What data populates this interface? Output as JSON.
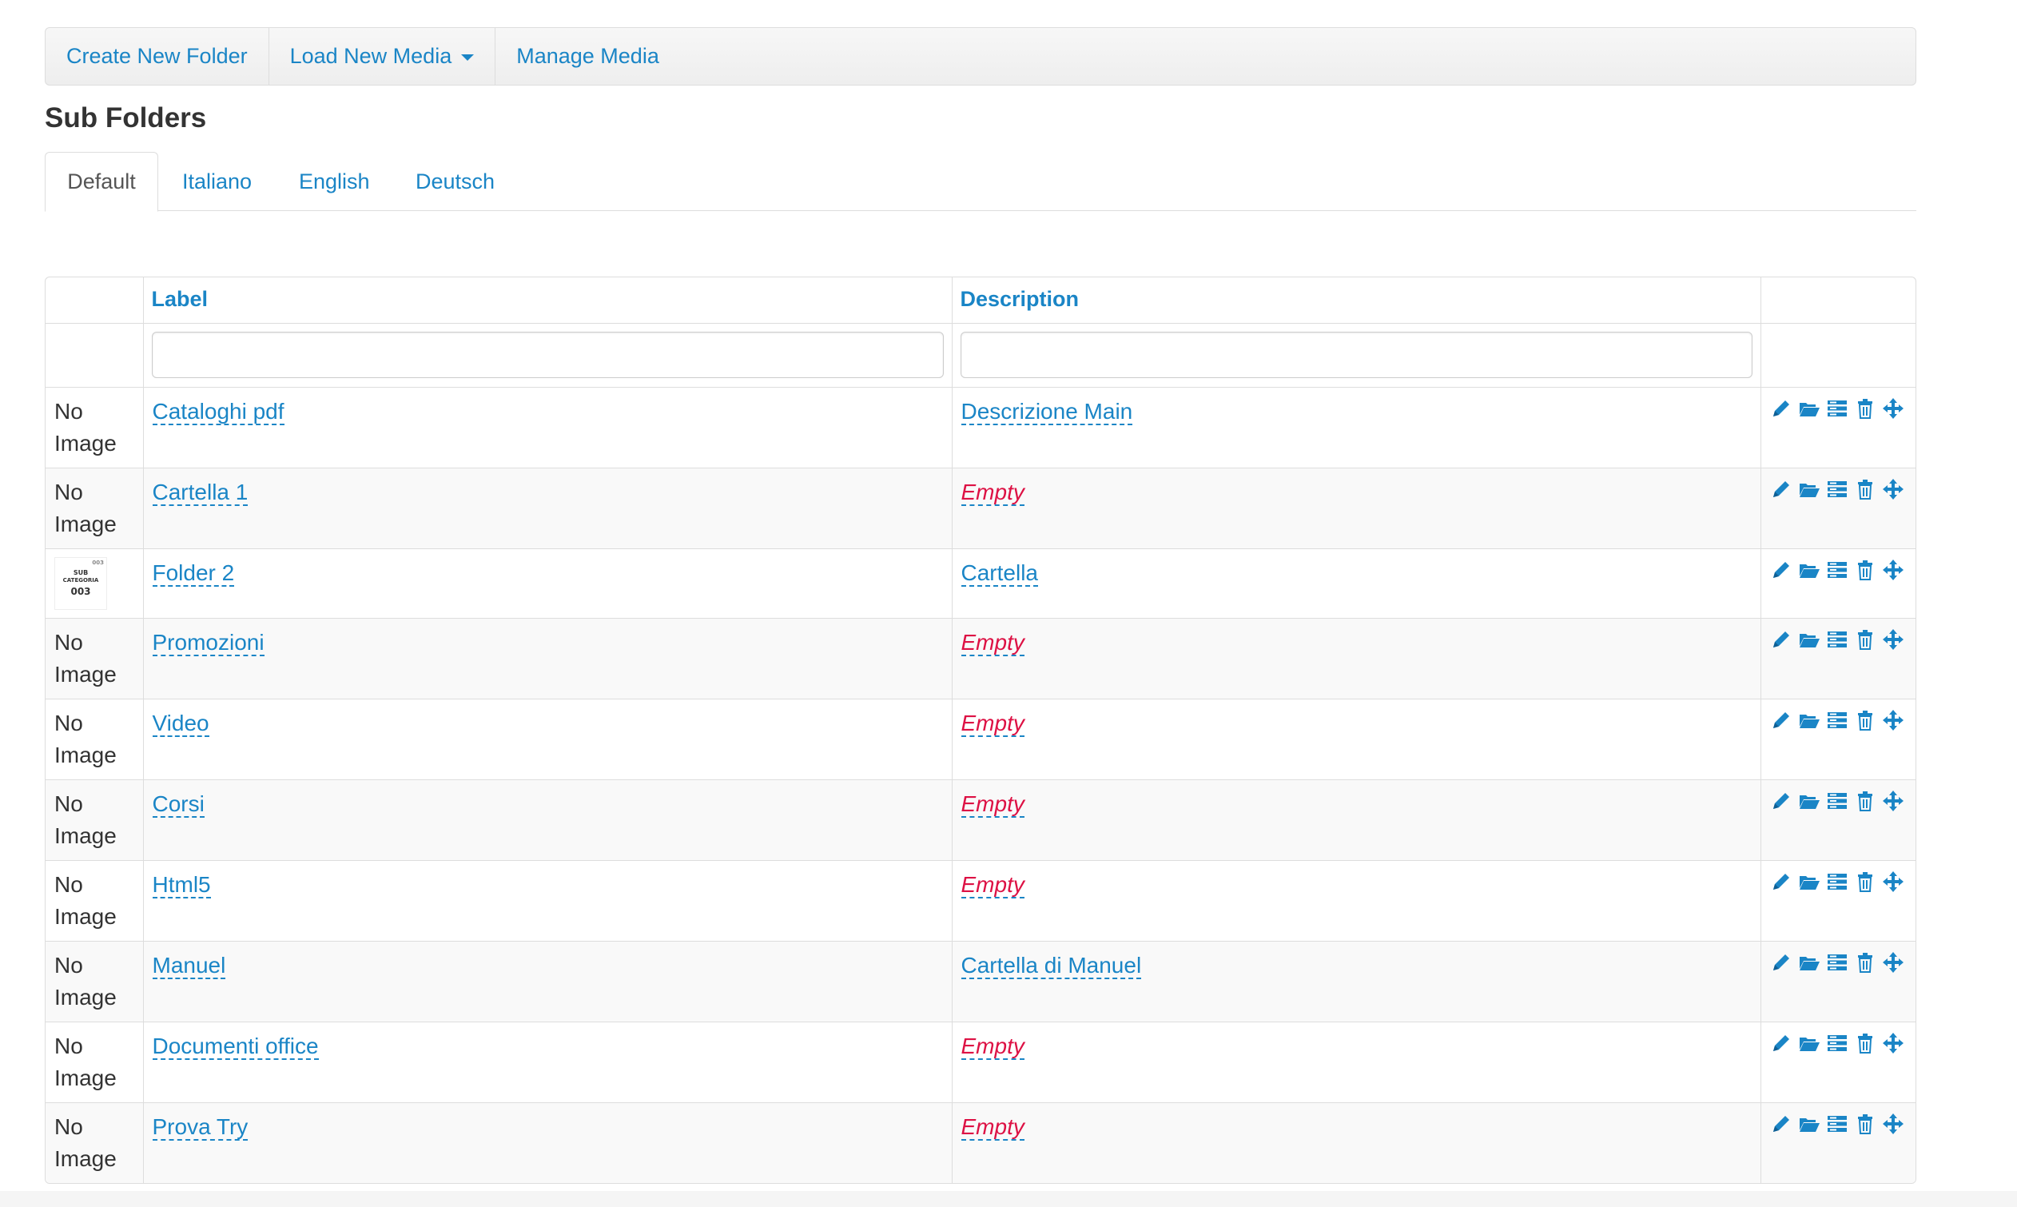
{
  "toolbar": {
    "create_folder": "Create New Folder",
    "load_media": "Load New Media",
    "manage_media": "Manage Media"
  },
  "page_title": "Sub Folders",
  "tabs": [
    {
      "label": "Default",
      "active": true
    },
    {
      "label": "Italiano"
    },
    {
      "label": "English"
    },
    {
      "label": "Deutsch"
    }
  ],
  "table": {
    "headers": {
      "label": "Label",
      "description": "Description"
    },
    "no_image_line1": "No",
    "no_image_line2": "Image",
    "thumbnail_text": {
      "line1": "SUB",
      "line2": "CATEGORIA",
      "line3": "003",
      "corner": "003"
    },
    "rows": [
      {
        "image": "No Image",
        "label": "Cataloghi pdf",
        "description": "Descrizione Main"
      },
      {
        "image": "No Image",
        "label": "Cartella 1",
        "description": "Empty"
      },
      {
        "image": "thumbnail",
        "label": "Folder 2",
        "description": "Cartella"
      },
      {
        "image": "No Image",
        "label": "Promozioni",
        "description": "Empty"
      },
      {
        "image": "No Image",
        "label": "Video",
        "description": "Empty"
      },
      {
        "image": "No Image",
        "label": "Corsi",
        "description": "Empty"
      },
      {
        "image": "No Image",
        "label": "Html5",
        "description": "Empty"
      },
      {
        "image": "No Image",
        "label": "Manuel",
        "description": "Cartella di Manuel"
      },
      {
        "image": "No Image",
        "label": "Documenti office",
        "description": "Empty"
      },
      {
        "image": "No Image",
        "label": "Prova Try",
        "description": "Empty"
      }
    ],
    "row_actions": [
      "pencil-icon",
      "folder-open-icon",
      "list-icon",
      "trash-icon",
      "move-icon"
    ]
  },
  "colors": {
    "link": "#1a85c6",
    "empty": "#dd1144",
    "border": "#dddddd"
  }
}
